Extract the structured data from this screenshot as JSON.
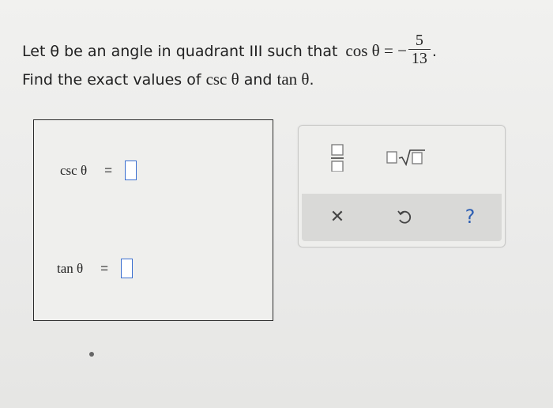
{
  "problem": {
    "intro": "Let θ be an angle in quadrant III such that",
    "cos_expr": "cos θ = −",
    "frac_num": "5",
    "frac_den": "13",
    "period": ".",
    "line2_prefix": "Find the exact values of",
    "csc_label": "csc θ",
    "and_text": "and",
    "tan_label": "tan θ",
    "line2_suffix": "."
  },
  "answers": [
    {
      "label": "csc θ",
      "eq": "="
    },
    {
      "label": "tan θ",
      "eq": "="
    }
  ],
  "palette": {
    "tools": [
      {
        "name": "fraction",
        "icon": "fraction-icon"
      },
      {
        "name": "mixed-radical",
        "icon": "sqrt-icon"
      },
      {
        "name": "clear",
        "icon": "close-icon"
      },
      {
        "name": "undo",
        "icon": "undo-icon"
      },
      {
        "name": "help",
        "icon": "help-icon"
      }
    ],
    "help_glyph": "?",
    "clear_glyph": "✕"
  },
  "colors": {
    "slot_border": "#3b6fd0",
    "help": "#2d5fb3"
  }
}
